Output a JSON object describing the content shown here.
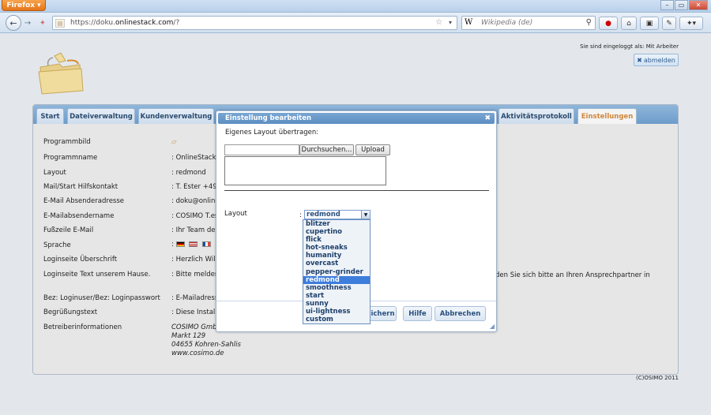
{
  "browser": {
    "app_button": "Firefox",
    "url_prefix": "https://doku.",
    "url_domain": "onlinestack.com",
    "url_suffix": "/?",
    "search_engine": "W",
    "search_placeholder": "Wikipedia (de)"
  },
  "header": {
    "login_status": "Sie sind eingeloggt als: Mit Arbeiter",
    "logout_label": "abmelden"
  },
  "tabs": [
    {
      "label": "Start"
    },
    {
      "label": "Dateiverwaltung"
    },
    {
      "label": "Kundenverwaltung"
    },
    {
      "label": "Aktivitätsprotokoll"
    },
    {
      "label": "Einstellungen"
    }
  ],
  "settings": [
    {
      "label": "Programmbild",
      "value": ""
    },
    {
      "label": "Programmname",
      "value": ": OnlineStack."
    },
    {
      "label": "Layout",
      "value": ": redmond"
    },
    {
      "label": "Mail/Start Hilfskontakt",
      "value": ": T. Ester +49"
    },
    {
      "label": "E-Mail Absenderadresse",
      "value": ": doku@online"
    },
    {
      "label": "E-Mailabsendername",
      "value": ": COSIMO T.es"
    },
    {
      "label": "Fußzeile E-Mail",
      "value": ": Ihr Team de"
    },
    {
      "label": "Sprache",
      "value": ":"
    },
    {
      "label": "Loginseite Überschrift",
      "value": ": Herzlich Will"
    },
    {
      "label": "Loginseite Text unserem Hause.",
      "value": ": Bitte melden"
    },
    {
      "label": "Bez: Loginuser/Bez: Loginpasswort",
      "value": ": E-Mailadress"
    },
    {
      "label": "Begrüßungstext",
      "value": ": Diese Install"
    },
    {
      "label": "Betreiberinformationen",
      "value": ""
    }
  ],
  "operator_info": [
    "COSIMO GmbH",
    "Markt 129",
    "04655 Kohren-Sahlis",
    "www.cosimo.de"
  ],
  "extra_text": "den Sie sich bitte an Ihren Ansprechpartner in",
  "footer": "(C)OSIMO 2011",
  "dialog": {
    "title": "Einstellung bearbeiten",
    "own_layout_label": "Eigenes Layout übertragen:",
    "browse_label": "Durchsuchen...",
    "upload_label": "Upload",
    "layout_label": "Layout",
    "layout_colon": ":",
    "selected_layout": "redmond",
    "save_label": "ichern",
    "help_label": "Hilfe",
    "cancel_label": "Abbrechen",
    "options": [
      "blitzer",
      "cupertino",
      "flick",
      "hot-sneaks",
      "humanity",
      "overcast",
      "pepper-grinder",
      "redmond",
      "smoothness",
      "start",
      "sunny",
      "ui-lightness",
      "custom"
    ]
  },
  "colors": {
    "tab_active": "#d0873a",
    "selected_option": "#3d7ddc"
  }
}
